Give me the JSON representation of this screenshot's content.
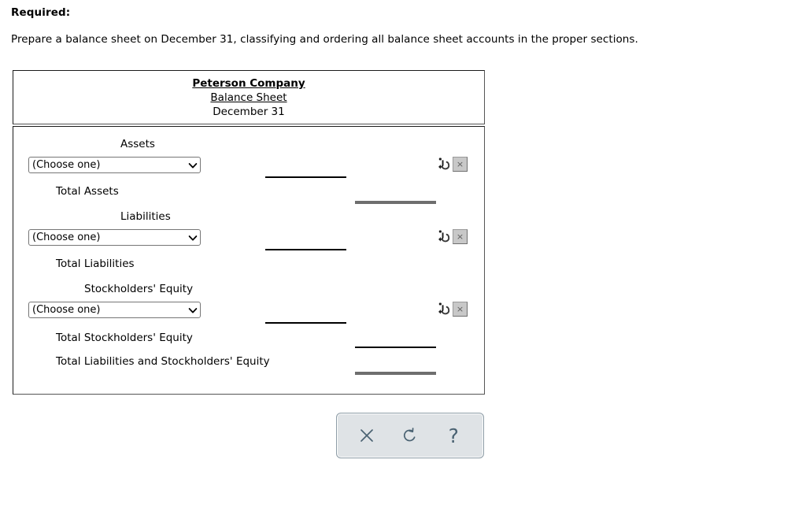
{
  "prompt": {
    "required_label": "Required:",
    "instruction": "Prepare a balance sheet on December 31, classifying and ordering all balance sheet accounts in the proper sections."
  },
  "worksheet": {
    "header": {
      "company": "Peterson Company",
      "statement": "Balance Sheet",
      "date": "December 31"
    },
    "select_placeholder": "(Choose one)",
    "select_options": [
      "(Choose one)"
    ],
    "sections": [
      {
        "heading": "Assets",
        "account_select_value": "(Choose one)",
        "total_label": "Total Assets"
      },
      {
        "heading": "Liabilities",
        "account_select_value": "(Choose one)",
        "total_label": "Total Liabilities"
      },
      {
        "heading": "Stockholders' Equity",
        "account_select_value": "(Choose one)",
        "total_label": "Total Stockholders' Equity"
      }
    ],
    "grand_total_label": "Total Liabilities and Stockholders' Equity",
    "row_actions": {
      "insert_icon": "insert-row-icon",
      "delete_icon": "delete-row-icon",
      "delete_glyph": "×"
    }
  },
  "toolbar": {
    "buttons": [
      {
        "name": "clear-button",
        "icon": "close-x-icon",
        "glyph": "✕"
      },
      {
        "name": "reset-button",
        "icon": "undo-arrow-icon",
        "glyph": "↺"
      },
      {
        "name": "help-button",
        "icon": "question-mark-icon",
        "glyph": "?"
      }
    ]
  },
  "colors": {
    "rule_single": "#000000",
    "rule_double": "#6e6e6e",
    "toolbar_bg": "#dfe3e6",
    "toolbar_border": "#8c9ba5",
    "toolbar_icon": "#4a6272"
  }
}
